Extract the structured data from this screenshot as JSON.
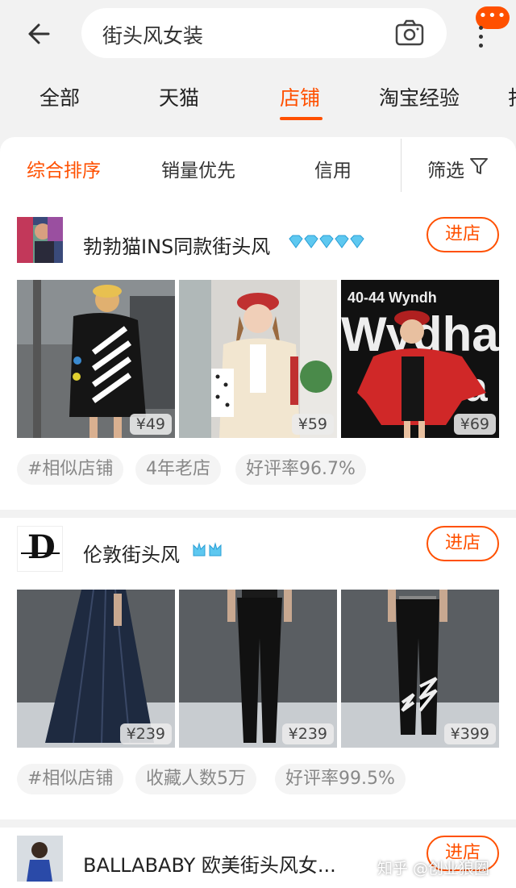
{
  "search": {
    "query": "街头风女装"
  },
  "header": {
    "badge_text": "•••"
  },
  "tabs": [
    {
      "label": "全部"
    },
    {
      "label": "天猫"
    },
    {
      "label": "店铺"
    },
    {
      "label": "淘宝经验"
    },
    {
      "label": "打"
    }
  ],
  "sort": {
    "options": [
      {
        "label": "综合排序"
      },
      {
        "label": "销量优先"
      },
      {
        "label": "信用"
      },
      {
        "label": "筛选"
      }
    ]
  },
  "shops": [
    {
      "name": "勃勃猫INS同款街头风",
      "enter_label": "进店",
      "rating_icon": "diamond-icon",
      "rating_count": 5,
      "products": [
        {
          "price": "¥49"
        },
        {
          "price": "¥59"
        },
        {
          "price": "¥69"
        }
      ],
      "tags": [
        "#相似店铺",
        "4年老店",
        "好评率96.7%"
      ]
    },
    {
      "name": "伦敦街头风",
      "enter_label": "进店",
      "logo_letter": "D",
      "rating_icon": "crown-icon",
      "rating_count": 2,
      "products": [
        {
          "price": "¥239"
        },
        {
          "price": "¥239"
        },
        {
          "price": "¥399"
        }
      ],
      "tags": [
        "#相似店铺",
        "收藏人数5万",
        "好评率99.5%"
      ]
    },
    {
      "name": "BALLABABY 欧美街头风女...",
      "enter_label": "进店"
    }
  ],
  "watermark": "知乎 @创业狼圈",
  "colors": {
    "accent": "#ff5000",
    "background": "#f2f2f2"
  }
}
